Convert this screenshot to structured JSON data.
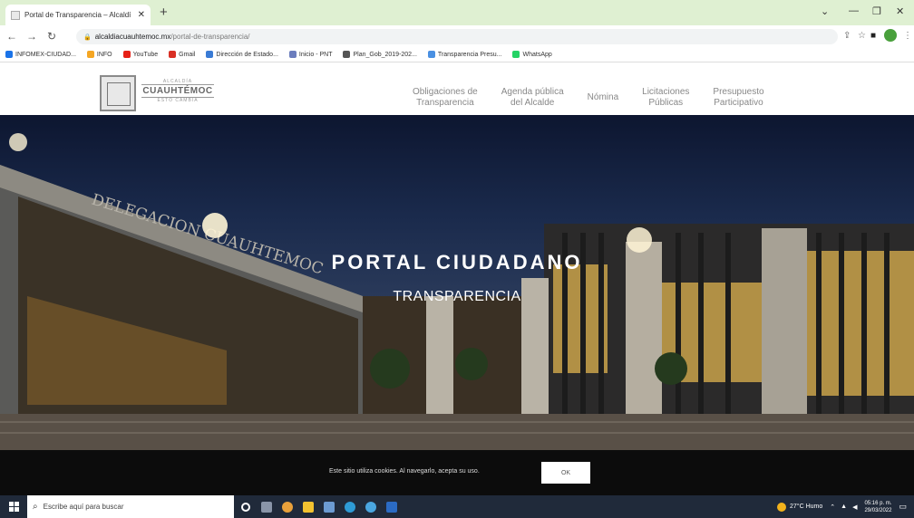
{
  "browser": {
    "tab_title": "Portal de Transparencia – Alcaldí",
    "url_host": "alcaldiacuauhtemoc.mx",
    "url_path": "/portal-de-transparencia/"
  },
  "bookmarks": [
    {
      "label": "INFOMEX-CIUDAD...",
      "color": "#1a73e8"
    },
    {
      "label": "INFO",
      "color": "#f5a623"
    },
    {
      "label": "YouTube",
      "color": "#e62117"
    },
    {
      "label": "Gmail",
      "color": "#d93025"
    },
    {
      "label": "Dirección de Estado...",
      "color": "#3a7bd5"
    },
    {
      "label": "Inicio - PNT",
      "color": "#6b7dbd"
    },
    {
      "label": "Plan_Gob_2019-202...",
      "color": "#555555"
    },
    {
      "label": "Transparencia Presu...",
      "color": "#4a90e2"
    },
    {
      "label": "WhatsApp",
      "color": "#25d366"
    }
  ],
  "site": {
    "logo_top": "ALCALDÍA",
    "logo_main": "CUAUHTÉMOC",
    "logo_bottom": "ESTO CAMBIA",
    "nav": [
      {
        "line1": "Obligaciones de",
        "line2": "Transparencia"
      },
      {
        "line1": "Agenda pública",
        "line2": "del Alcalde"
      },
      {
        "line1": "Nómina",
        "line2": ""
      },
      {
        "line1": "Licitaciones",
        "line2": "Públicas"
      },
      {
        "line1": "Presupuesto",
        "line2": "Participativo"
      }
    ]
  },
  "hero": {
    "title": "PORTAL CIUDADANO",
    "subtitle": "TRANSPARENCIA",
    "facade_text": "DELEGACION CUAUHTEMOC"
  },
  "cookie": {
    "text": "Este sitio utiliza cookies. Al navegarlo, acepta su uso.",
    "button": "OK"
  },
  "taskbar": {
    "search_placeholder": "Escribe aquí para buscar",
    "weather": "27°C Humo",
    "time": "05:16 p. m.",
    "date": "29/03/2022"
  }
}
